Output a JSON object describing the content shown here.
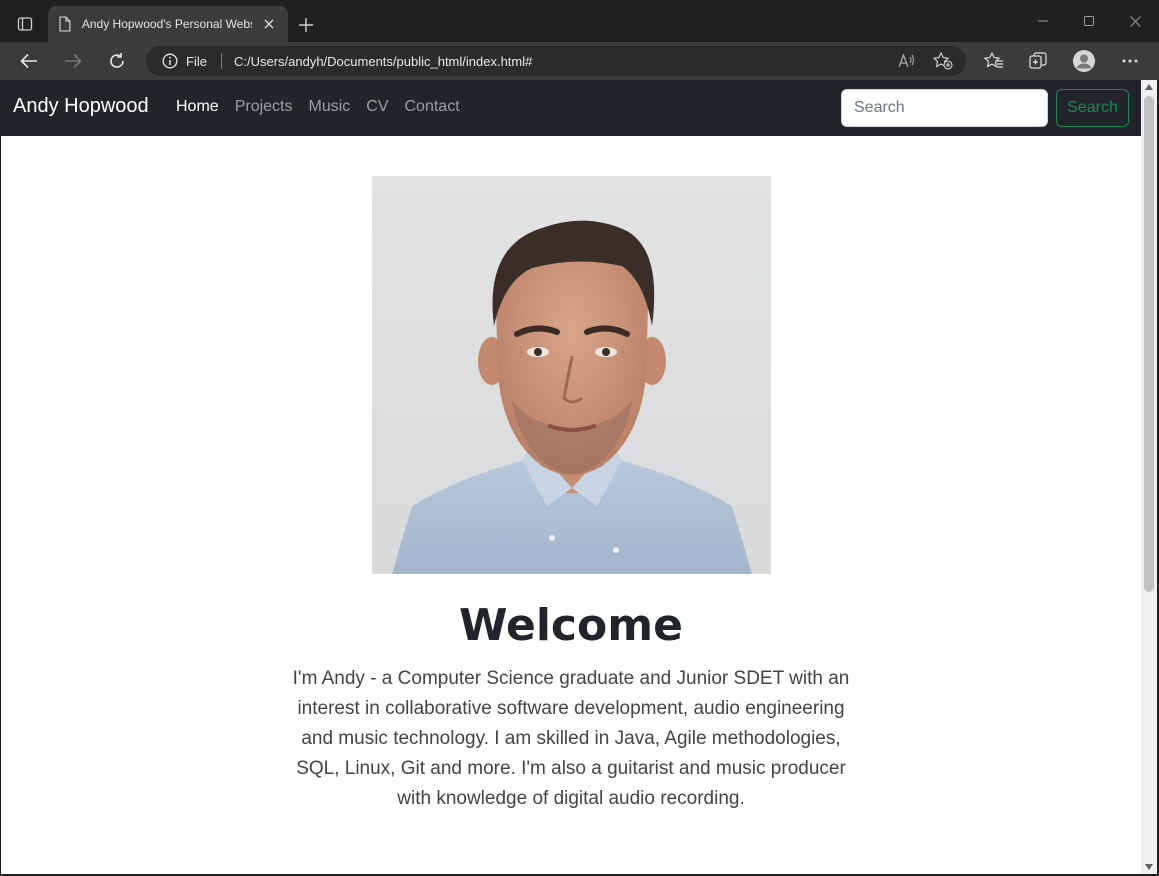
{
  "browser": {
    "tab_title": "Andy Hopwood's Personal Website",
    "address_scheme": "File",
    "address_url": "C:/Users/andyh/Documents/public_html/index.html#"
  },
  "site": {
    "brand": "Andy Hopwood",
    "nav": [
      {
        "label": "Home",
        "active": true
      },
      {
        "label": "Projects",
        "active": false
      },
      {
        "label": "Music",
        "active": false
      },
      {
        "label": "CV",
        "active": false
      },
      {
        "label": "Contact",
        "active": false
      }
    ],
    "search_placeholder": "Search",
    "search_button": "Search"
  },
  "main": {
    "heading": "Welcome",
    "intro": "I'm Andy - a Computer Science graduate and Junior SDET with an interest in collaborative software development, audio engineering and music technology. I am skilled in Java, Agile methodologies, SQL, Linux, Git and more. I'm also a guitarist and music producer with knowledge of digital audio recording."
  }
}
